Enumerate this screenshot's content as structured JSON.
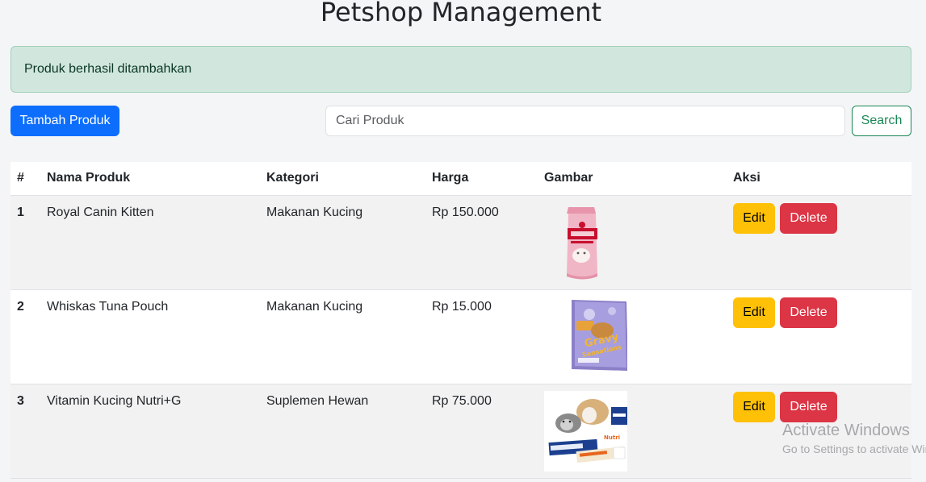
{
  "header": {
    "title": "Petshop Management"
  },
  "alert": {
    "message": "Produk berhasil ditambahkan"
  },
  "toolbar": {
    "add_label": "Tambah Produk",
    "search_placeholder": "Cari Produk",
    "search_label": "Search"
  },
  "table": {
    "headers": [
      "#",
      "Nama Produk",
      "Kategori",
      "Harga",
      "Gambar",
      "Aksi"
    ],
    "rows": [
      {
        "no": "1",
        "name": "Royal Canin Kitten",
        "category": "Makanan Kucing",
        "price": "Rp 150.000",
        "image": "royal-canin-kitten-bag",
        "edit": "Edit",
        "delete": "Delete"
      },
      {
        "no": "2",
        "name": "Whiskas Tuna Pouch",
        "category": "Makanan Kucing",
        "price": "Rp 15.000",
        "image": "gravy-sensations-pouch",
        "edit": "Edit",
        "delete": "Delete"
      },
      {
        "no": "3",
        "name": "Vitamin Kucing Nutri+G",
        "category": "Suplemen Hewan",
        "price": "Rp 75.000",
        "image": "virbac-nutri-plus-gel",
        "edit": "Edit",
        "delete": "Delete"
      }
    ]
  },
  "watermark": {
    "line1": "Activate Windows",
    "line2": "Go to Settings to activate Windows."
  },
  "colors": {
    "primary": "#0d6efd",
    "success": "#198754",
    "warning": "#ffc107",
    "danger": "#dc3545",
    "alert_bg": "#d1e7dd"
  }
}
